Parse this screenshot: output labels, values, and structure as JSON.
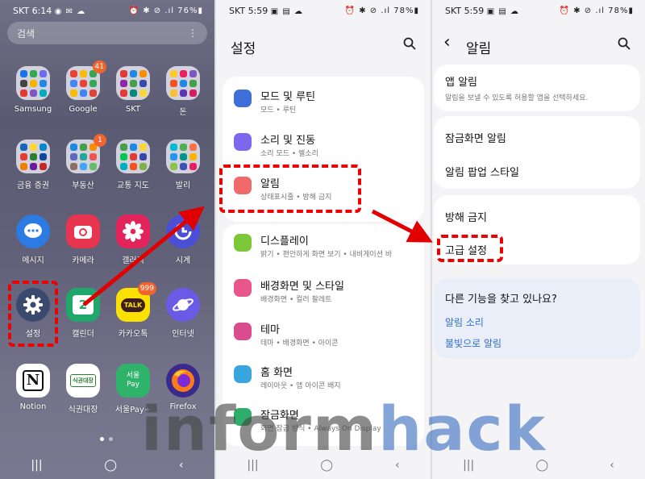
{
  "home": {
    "status": {
      "carrier": "SKT",
      "time": "6:14",
      "icons": "◉ ✉ ☁",
      "right": "⏰ ✱ ⊘ .ıl 76%▮"
    },
    "search_placeholder": "검색",
    "menu_icon": "⋮",
    "apps": [
      {
        "label": "Samsung",
        "kind": "folder"
      },
      {
        "label": "Google",
        "kind": "folder",
        "badge": "41"
      },
      {
        "label": "SKT",
        "kind": "folder"
      },
      {
        "label": "돈",
        "kind": "folder"
      },
      {
        "label": "금융 증권",
        "kind": "folder"
      },
      {
        "label": "부동산",
        "kind": "folder",
        "badge": "1"
      },
      {
        "label": "교통 지도",
        "kind": "folder"
      },
      {
        "label": "발리",
        "kind": "folder"
      },
      {
        "label": "메시지",
        "kind": "app"
      },
      {
        "label": "카메라",
        "kind": "app"
      },
      {
        "label": "갤러리",
        "kind": "app"
      },
      {
        "label": "시계",
        "kind": "app"
      },
      {
        "label": "설정",
        "kind": "app"
      },
      {
        "label": "캘린더",
        "kind": "app",
        "icon_text": "2"
      },
      {
        "label": "카카오톡",
        "kind": "app",
        "badge": "999",
        "icon_text": "TALK"
      },
      {
        "label": "인터넷",
        "kind": "app"
      },
      {
        "label": "Notion",
        "kind": "app",
        "icon_text": "N"
      },
      {
        "label": "식권대장",
        "kind": "app",
        "icon_text": "식권대장"
      },
      {
        "label": "서울Pay+",
        "kind": "app",
        "icon_text": "서울 Pay"
      },
      {
        "label": "Firefox",
        "kind": "app"
      }
    ],
    "nav": [
      "|||",
      "◯",
      "‹"
    ]
  },
  "settings": {
    "status": {
      "carrier": "SKT",
      "time": "5:59",
      "icons": "▣ ▤ ☁",
      "right": "⏰ ✱ ⊘ .ıl 78%▮"
    },
    "title": "설정",
    "items": [
      {
        "title": "모드 및 루틴",
        "sub": "모드 • 루틴",
        "color": "#3e6fd8"
      },
      {
        "title": "소리 및 진동",
        "sub": "소리 모드 • 벨소리",
        "color": "#7b68ee"
      },
      {
        "title": "알림",
        "sub": "상태표시줄 • 방해 금지",
        "color": "#f06a6a"
      },
      {
        "title": "디스플레이",
        "sub": "밝기 • 편안하게 화면 보기 • 내비게이션 바",
        "color": "#7cc63a"
      },
      {
        "title": "배경화면 및 스타일",
        "sub": "배경화면 • 컬러 팔레트",
        "color": "#e8578a"
      },
      {
        "title": "테마",
        "sub": "테마 • 배경화면 • 아이콘",
        "color": "#d94d8f"
      },
      {
        "title": "홈 화면",
        "sub": "레이아웃 • 앱 아이콘 배지",
        "color": "#3aa6e0"
      },
      {
        "title": "잠금화면",
        "sub": "화면 잠금 방식 • Always On Display",
        "color": "#2fae6b"
      }
    ],
    "nav": [
      "|||",
      "◯",
      "‹"
    ]
  },
  "notifications": {
    "status": {
      "carrier": "SKT",
      "time": "5:59",
      "icons": "▣ ▤ ☁",
      "right": "⏰ ✱ ⊘ .ıl 78%▮"
    },
    "back": "‹",
    "title": "알림",
    "app_notifications": {
      "title": "앱 알림",
      "sub": "알림을 보낼 수 있도록 허용할 앱을 선택하세요."
    },
    "lock_screen": "잠금화면 알림",
    "popup_style": "알림 팝업 스타일",
    "dnd": "방해 금지",
    "advanced": "고급 설정",
    "suggest": {
      "title": "다른 기능을 찾고 있나요?",
      "links": [
        "알림 소리",
        "불빛으로 알림"
      ]
    },
    "nav": [
      "|||",
      "◯",
      "‹"
    ]
  },
  "watermark": {
    "part1": "inform",
    "part2": "hack"
  },
  "colors": {
    "highlight": "#e00000",
    "link": "#2f6fce"
  }
}
